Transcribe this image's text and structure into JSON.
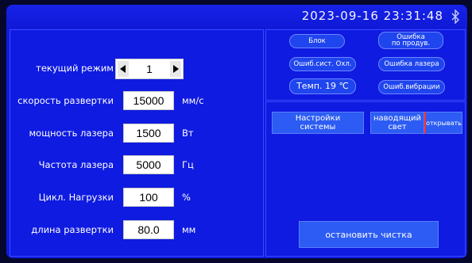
{
  "header": {
    "datetime": "2023-09-16 23:31:48",
    "bluetooth_icon": "bluetooth-icon"
  },
  "params": {
    "mode": {
      "label": "текущий режим",
      "value": "1"
    },
    "scan_speed": {
      "label": "скорость развертки",
      "value": "15000",
      "unit": "мм/с"
    },
    "laser_power": {
      "label": "мощность лазера",
      "value": "1500",
      "unit": "Вт"
    },
    "laser_freq": {
      "label": "Частота лазера",
      "value": "5000",
      "unit": "Гц"
    },
    "duty_cycle": {
      "label": "Цикл. Нагрузки",
      "value": "100",
      "unit": "%"
    },
    "scan_length": {
      "label": "длина развертки",
      "value": "80.0",
      "unit": "мм"
    }
  },
  "status": {
    "lock": "Блок",
    "product_error_line1": "Ошибка",
    "product_error_line2": "по продув.",
    "cooling_error": "Ошиб.сист. Охл.",
    "laser_error": "Ошибка лазера",
    "temperature": "Темп.  19 ℃",
    "vibration_error": "Ошиб.вибрации"
  },
  "controls": {
    "system_settings_line1": "Настройки",
    "system_settings_line2": "системы",
    "guide_light_line1": "наводящий",
    "guide_light_line2": "свет",
    "open": "открывать",
    "stop_cleaning": "остановить чистка"
  },
  "colors": {
    "background": "#0f1be0",
    "button": "#2c5cf4",
    "accent_red": "#ff2a2a"
  }
}
